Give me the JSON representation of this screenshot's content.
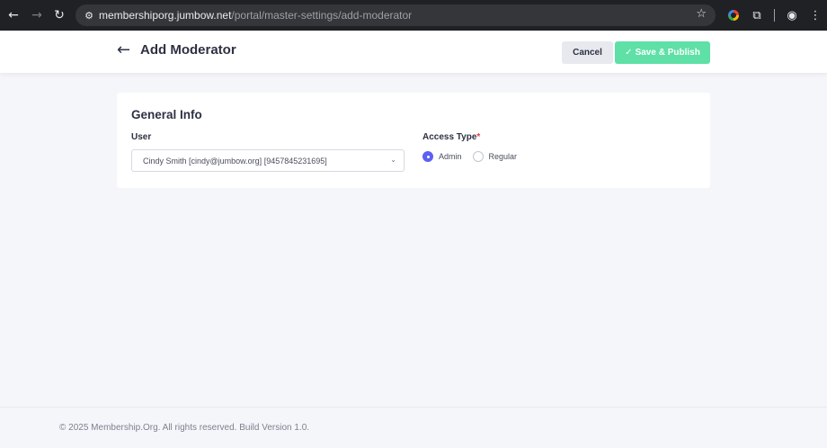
{
  "browser": {
    "url_domain": "membershiporg.jumbow.net",
    "url_path": "/portal/master-settings/add-moderator",
    "icons": [
      "back-arrow-icon",
      "forward-arrow-icon",
      "reload-icon",
      "site-settings-icon",
      "bookmark-star-icon",
      "color-extension-icon",
      "extensions-puzzle-icon",
      "profile-icon",
      "kebab-menu-icon"
    ]
  },
  "header": {
    "title": "Add Moderator",
    "cancel_label": "Cancel",
    "save_label": "Save & Publish"
  },
  "form": {
    "section_title": "General Info",
    "user_label": "User",
    "user_value": "Cindy Smith [cindy@jumbow.org] [9457845231695]",
    "access_label": "Access Type",
    "required_mark": "*",
    "options": [
      {
        "label": "Admin",
        "checked": true
      },
      {
        "label": "Regular",
        "checked": false
      }
    ]
  },
  "footer": {
    "text": "© 2025 Membership.Org. All rights reserved. Build Version 1.0."
  },
  "colors": {
    "accent": "#5b61f2",
    "save_button": "#5ee0a6",
    "required": "#e53945",
    "text_dark": "#2d3142"
  }
}
